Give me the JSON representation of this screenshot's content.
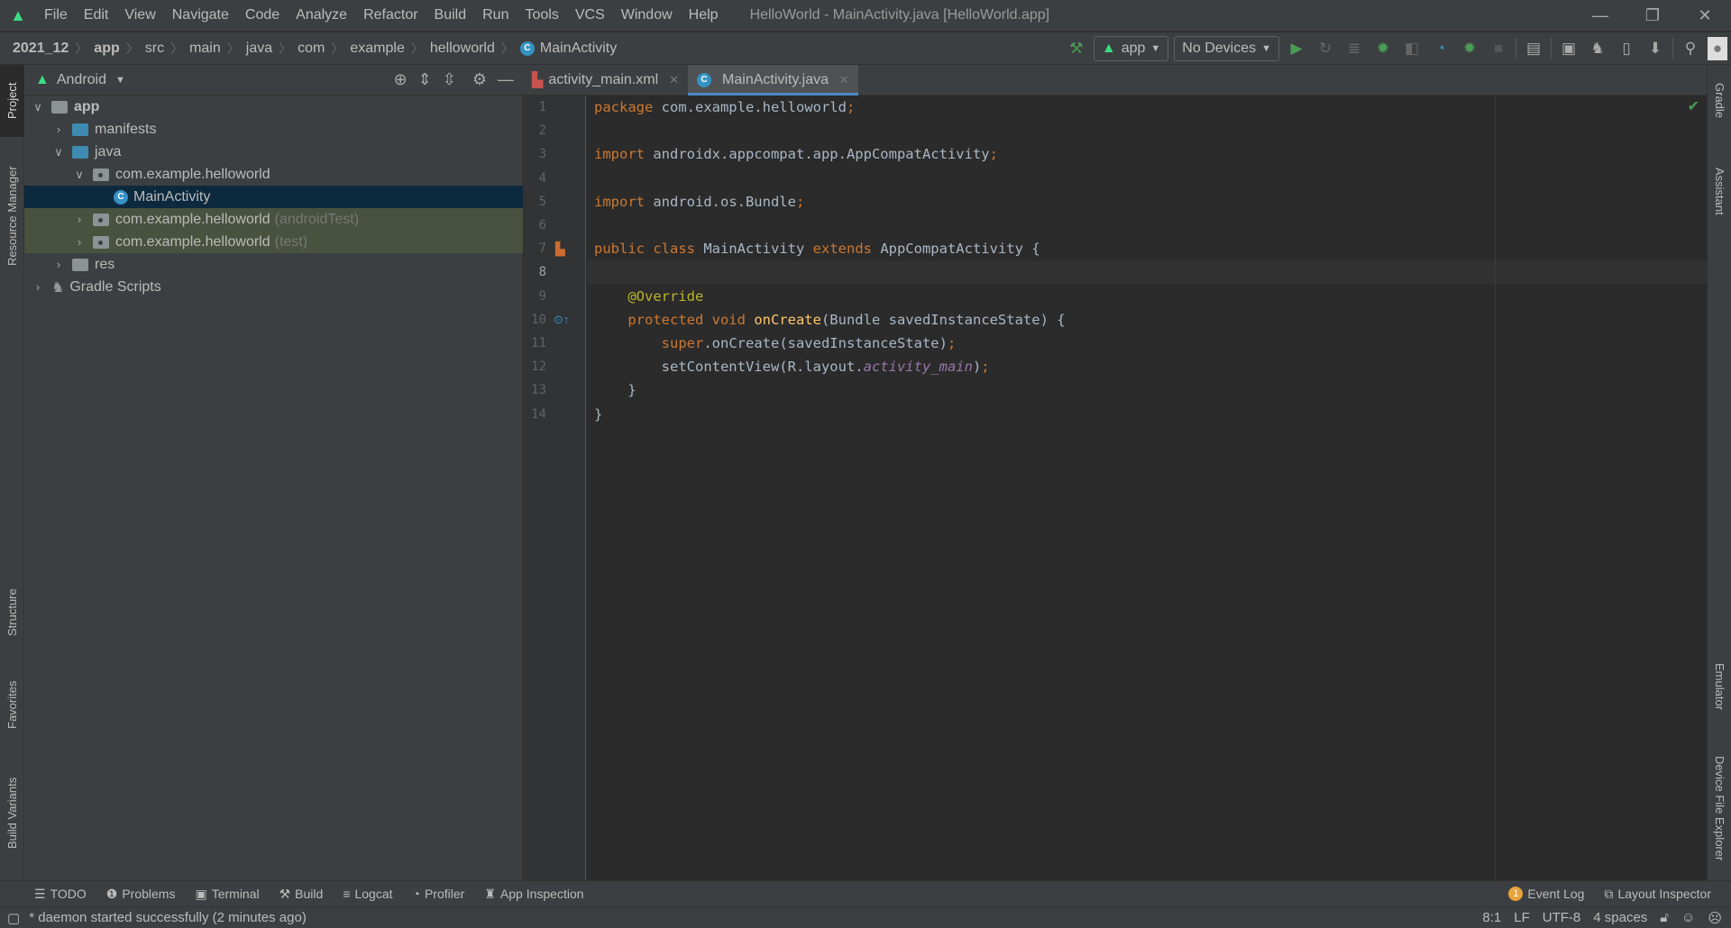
{
  "menubar": {
    "items": [
      "File",
      "Edit",
      "View",
      "Navigate",
      "Code",
      "Analyze",
      "Refactor",
      "Build",
      "Run",
      "Tools",
      "VCS",
      "Window",
      "Help"
    ],
    "window_title": "HelloWorld - MainActivity.java [HelloWorld.app]"
  },
  "breadcrumb": [
    "2021_12",
    "app",
    "src",
    "main",
    "java",
    "com",
    "example",
    "helloworld",
    "MainActivity"
  ],
  "toolbar": {
    "run_config": "app",
    "device": "No Devices"
  },
  "left_stripe": [
    "Project",
    "Resource Manager",
    "Structure",
    "Favorites",
    "Build Variants"
  ],
  "right_stripe": [
    "Gradle",
    "Assistant",
    "Emulator",
    "Device File Explorer"
  ],
  "project": {
    "view": "Android",
    "tree": [
      {
        "label": "app",
        "level": 0,
        "expanded": true
      },
      {
        "label": "manifests",
        "level": 1,
        "expanded": false
      },
      {
        "label": "java",
        "level": 1,
        "expanded": true
      },
      {
        "label": "com.example.helloworld",
        "level": 2,
        "expanded": true
      },
      {
        "label": "MainActivity",
        "level": 3,
        "selected": true
      },
      {
        "label": "com.example.helloworld",
        "suffix": "(androidTest)",
        "level": 2,
        "expanded": false
      },
      {
        "label": "com.example.helloworld",
        "suffix": "(test)",
        "level": 2,
        "expanded": false
      },
      {
        "label": "res",
        "level": 1,
        "expanded": false
      },
      {
        "label": "Gradle Scripts",
        "level": 0,
        "expanded": false
      }
    ]
  },
  "tabs": [
    {
      "label": "activity_main.xml",
      "active": false
    },
    {
      "label": "MainActivity.java",
      "active": true
    }
  ],
  "editor": {
    "current_line": 8,
    "line_numbers": [
      "1",
      "2",
      "3",
      "4",
      "5",
      "6",
      "7",
      "8",
      "9",
      "10",
      "11",
      "12",
      "13",
      "14"
    ]
  },
  "bottom_tools": [
    "TODO",
    "Problems",
    "Terminal",
    "Build",
    "Logcat",
    "Profiler",
    "App Inspection"
  ],
  "bottom_right_tools": [
    "Event Log",
    "Layout Inspector"
  ],
  "event_log_count": "1",
  "status": {
    "message": "* daemon started successfully (2 minutes ago)",
    "position": "8:1",
    "line_sep": "LF",
    "encoding": "UTF-8",
    "indent": "4 spaces"
  },
  "colors": {
    "accent": "#4a88c7",
    "android_green": "#3ddc84",
    "keyword": "#cc7832",
    "function": "#ffc66d",
    "annotation": "#bbb529"
  }
}
